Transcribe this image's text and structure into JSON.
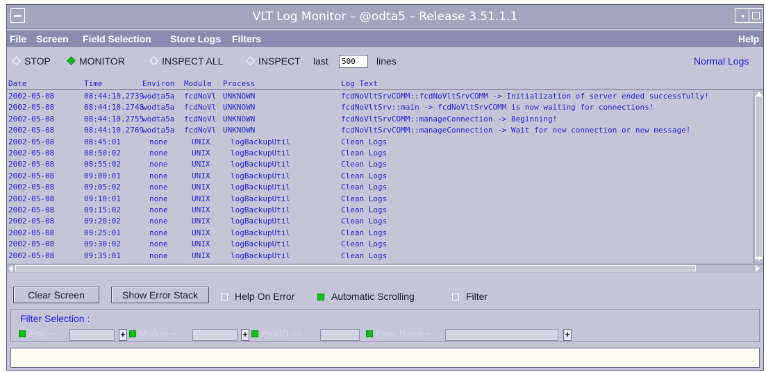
{
  "window": {
    "title": "VLT Log Monitor – @odta5 – Release 3.51.1.1"
  },
  "menu": {
    "items": [
      "File",
      "Screen",
      "Field Selection",
      "Store Logs",
      "Filters"
    ],
    "help": "Help"
  },
  "modes": {
    "stop": "STOP",
    "monitor": "MONITOR",
    "inspect_all": "INSPECT ALL",
    "inspect": "INSPECT",
    "selected": "MONITOR",
    "last_label": "last",
    "lines_value": "500",
    "lines_label": "lines",
    "normal_logs": "Normal Logs"
  },
  "log": {
    "columns": [
      "Date",
      "Time",
      "Environ",
      "Module",
      "Process",
      "Log Text"
    ],
    "rows": [
      [
        "2002-05-08",
        "08:44:10.2739",
        "wodta5a",
        "fcdNoVl",
        "UNKNOWN",
        "",
        "fcdNoVltSrvCOMM::fcdNoVltSrvCOMM -> Initialization of server ended successfully!"
      ],
      [
        "2002-05-08",
        "08:44:10.2748",
        "wodta5a",
        "fcdNoVl",
        "UNKNOWN",
        "",
        "fcdNoVltSrv::main -> fcdNoVltSrvCOMM is now waiting for connections!"
      ],
      [
        "2002-05-08",
        "08:44:10.2755",
        "wodta5a",
        "fcdNoVl",
        "UNKNOWN",
        "",
        "fcdNoVltSrvCOMM::manageConnection -> Beginning!"
      ],
      [
        "2002-05-08",
        "08:44:10.2769",
        "wodta5a",
        "fcdNoVl",
        "UNKNOWN",
        "",
        "fcdNoVltSrvCOMM::manageConnection -> Wait for new connection or new message!"
      ],
      [
        "2002-05-08",
        "08:45:01",
        "none",
        "UNIX",
        "",
        "logBackupUtil",
        "Clean Logs"
      ],
      [
        "2002-05-08",
        "08:50:02",
        "none",
        "UNIX",
        "",
        "logBackupUtil",
        "Clean Logs"
      ],
      [
        "2002-05-08",
        "08:55:02",
        "none",
        "UNIX",
        "",
        "logBackupUtil",
        "Clean Logs"
      ],
      [
        "2002-05-08",
        "09:00:01",
        "none",
        "UNIX",
        "",
        "logBackupUtil",
        "Clean Logs"
      ],
      [
        "2002-05-08",
        "09:05:02",
        "none",
        "UNIX",
        "",
        "logBackupUtil",
        "Clean Logs"
      ],
      [
        "2002-05-08",
        "09:10:01",
        "none",
        "UNIX",
        "",
        "logBackupUtil",
        "Clean Logs"
      ],
      [
        "2002-05-08",
        "09:15:02",
        "none",
        "UNIX",
        "",
        "logBackupUtil",
        "Clean Logs"
      ],
      [
        "2002-05-08",
        "09:20:02",
        "none",
        "UNIX",
        "",
        "logBackupUtil",
        "Clean Logs"
      ],
      [
        "2002-05-08",
        "09:25:01",
        "none",
        "UNIX",
        "",
        "logBackupUtil",
        "Clean Logs"
      ],
      [
        "2002-05-08",
        "09:30:02",
        "none",
        "UNIX",
        "",
        "logBackupUtil",
        "Clean Logs"
      ],
      [
        "2002-05-08",
        "09:35:01",
        "none",
        "UNIX",
        "",
        "logBackupUtil",
        "Clean Logs"
      ]
    ]
  },
  "controls": {
    "clear_screen": "Clear Screen",
    "show_error_stack": "Show Error Stack",
    "help_on_error": "Help On Error",
    "help_on_error_checked": false,
    "automatic_scrolling": "Automatic Scrolling",
    "automatic_scrolling_checked": true,
    "filter": "Filter",
    "filter_checked": false
  },
  "filter_selection": {
    "title": "Filter Selection :",
    "fields": [
      {
        "label": "Env. ~",
        "value": ""
      },
      {
        "label": "Module ~",
        "value": ""
      },
      {
        "label": "ProcID ==",
        "value": ""
      },
      {
        "label": "Proc. Name ~",
        "value": ""
      }
    ],
    "plus": "+"
  },
  "status_text": "",
  "colors": {
    "window_bg": "#c4c6d8",
    "menubar_bg": "#8a8caf",
    "log_text": "#2424cc",
    "accent_link": "#2020e0",
    "check_on": "#0fc10f"
  },
  "icons": {
    "radio": "diamond-radio-icon",
    "checkbox": "square-checkbox-icon"
  }
}
